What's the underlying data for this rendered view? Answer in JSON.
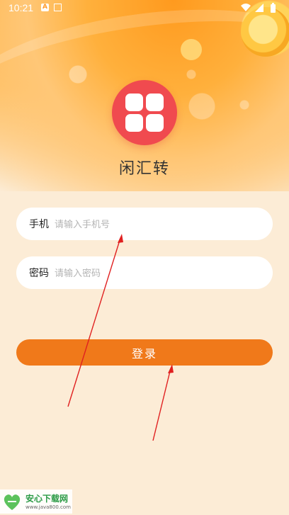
{
  "status_bar": {
    "time": "10:21",
    "notification_icon": "A"
  },
  "app": {
    "title": "闲汇转"
  },
  "form": {
    "phone": {
      "label": "手机",
      "placeholder": "请输入手机号",
      "value": ""
    },
    "password": {
      "label": "密码",
      "placeholder": "请输入密码",
      "value": ""
    },
    "login_label": "登录"
  },
  "watermark": {
    "name": "安心下载网",
    "url": "www.java800.com"
  },
  "colors": {
    "accent": "#f0791a",
    "logo": "#f04a4f",
    "background": "#fcecd6",
    "annotation_arrow": "#e02020"
  }
}
